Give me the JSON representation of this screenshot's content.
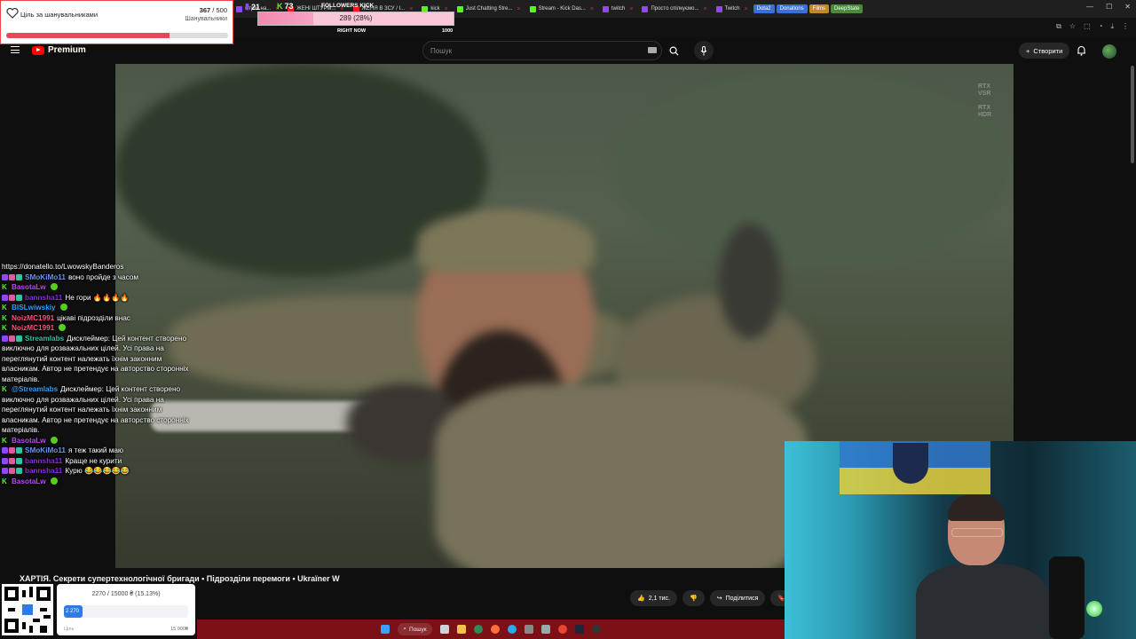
{
  "browser": {
    "tabs": [
      {
        "label": "Стрім на...",
        "color": "#9146ff"
      },
      {
        "label": "ЖЕНІ ШТУРМ...",
        "color": "#e62117"
      },
      {
        "label": "ЖЕНЯ В ЗСУ / I...",
        "color": "#e62117"
      },
      {
        "label": "kick",
        "color": "#53fc18"
      },
      {
        "label": "Just Chatting Stre...",
        "color": "#53fc18"
      },
      {
        "label": "Stream - Kick Das...",
        "color": "#53fc18"
      },
      {
        "label": "twitch",
        "color": "#9146ff"
      },
      {
        "label": "Просто спілкуємо...",
        "color": "#9146ff"
      },
      {
        "label": "Twitch",
        "color": "#9146ff"
      }
    ],
    "chips": [
      {
        "label": "Dota2",
        "color": "#3a6fd8"
      },
      {
        "label": "Donations",
        "color": "#3a6fd8"
      },
      {
        "label": "Films",
        "color": "#c08a2a"
      },
      {
        "label": "DeepState",
        "color": "#4a8a3a"
      }
    ]
  },
  "youtube": {
    "logo": "Premium",
    "search_placeholder": "Пошук",
    "create_label": "Створити",
    "video_title": "ХАРТІЯ. Секрети супертехнологічної бригади • Підрозділи перемоги • Ukraїner W",
    "likes": "2,1 тис.",
    "share_label": "Поділитися",
    "rtx_line1": "RTX",
    "rtx_line2": "VSR",
    "rtx_line3": "RTX",
    "rtx_line4": "HDR"
  },
  "follower_goal": {
    "label": "Ціль за шанувальниками",
    "current": "367",
    "sep": " / ",
    "target": "500",
    "sub": "Шанувальники",
    "progress": 0.734
  },
  "kick_widget": {
    "stat1": "21",
    "stat2": "73",
    "header": "FOLLOWERS KICK",
    "bar_text": "289 (28%)",
    "progress": 0.28,
    "right_now": "RIGHT NOW",
    "max": "1000"
  },
  "chat": {
    "link": "https://donatello.to/LwowskyBanderos",
    "messages": [
      {
        "user": "SMoKiMo11",
        "color": "#6495ed",
        "text": "воно пройде з часом",
        "platform": "twitch"
      },
      {
        "user": "BasotaLw",
        "color": "#b84de6",
        "text": "",
        "platform": "kick"
      },
      {
        "user": "bannsha11",
        "color": "#8a2be2",
        "text": "Не гори 🔥🔥🔥🔥",
        "platform": "twitch"
      },
      {
        "user": "BISLwiwskiy",
        "color": "#2aa2ff",
        "text": "",
        "platform": "kick"
      },
      {
        "user": "NoizMC1991",
        "color": "#ff4f7b",
        "text": "цікаві підрозділи внас",
        "platform": "kick"
      },
      {
        "user": "NoizMC1991",
        "color": "#ff4f7b",
        "text": "",
        "platform": "kick"
      },
      {
        "user": "Streamlabs",
        "color": "#31c3a2",
        "text": "Дисклеймер: Цей контент створено виключно для розважальних цілей. Усі права на переглянутий контент належать їхнім законним власникам. Автор не претендує на авторство сторонніх матеріалів.",
        "platform": "twitch"
      },
      {
        "user": "@Streamlabs",
        "color": "#2aa2ff",
        "text": "Дисклеймер: Цей контент створено виключно для розважальних цілей. Усі права на переглянутий контент належать їхнім законним власникам. Автор не претендує на авторство сторонніх матеріалів.",
        "platform": "kick"
      },
      {
        "user": "BasotaLw",
        "color": "#b84de6",
        "text": "",
        "platform": "kick"
      },
      {
        "user": "SMoKiMo11",
        "color": "#6495ed",
        "text": "я теж такий маю",
        "platform": "twitch"
      },
      {
        "user": "bannsha11",
        "color": "#8a2be2",
        "text": "Краще не курити",
        "platform": "twitch"
      },
      {
        "user": "bannsha11",
        "color": "#8a2be2",
        "text": "Курю 😂😂😂😂😂",
        "platform": "twitch"
      },
      {
        "user": "BasotaLw",
        "color": "#b84de6",
        "text": "",
        "platform": "kick"
      }
    ]
  },
  "donation": {
    "title": "2270 / 15000 ₴ (15.13%)",
    "fill_text": "2 270",
    "progress": 0.1513,
    "left_label": "Ціль",
    "right_label": "15 000₴"
  },
  "taskbar": {
    "search_label": "Пошук"
  }
}
